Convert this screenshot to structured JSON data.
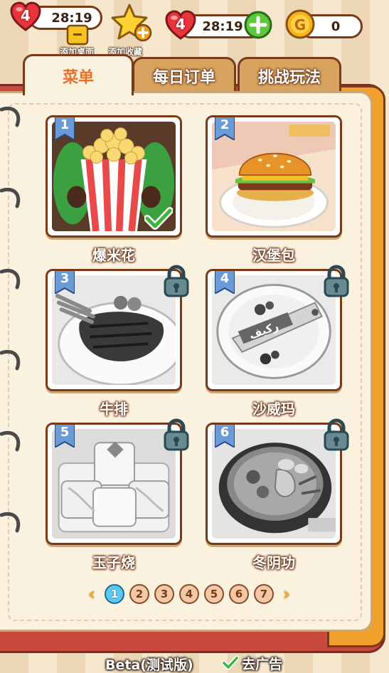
{
  "hud": {
    "left_lives": "4",
    "left_timer": "28:19",
    "right_lives": "4",
    "right_timer": "28:19",
    "coins": "0",
    "add_desktop_label": "添加桌面",
    "add_favorite_label": "添加收藏"
  },
  "tabs": [
    {
      "label": "菜单",
      "active": true
    },
    {
      "label": "每日订单",
      "active": false
    },
    {
      "label": "挑战玩法",
      "active": false
    }
  ],
  "recipes": [
    {
      "number": "1",
      "name": "爆米花",
      "locked": false,
      "completed": true,
      "icon": "popcorn-icon"
    },
    {
      "number": "2",
      "name": "汉堡包",
      "locked": false,
      "completed": false,
      "icon": "burger-icon"
    },
    {
      "number": "3",
      "name": "牛排",
      "locked": true,
      "completed": false,
      "icon": "steak-icon"
    },
    {
      "number": "4",
      "name": "沙威玛",
      "locked": true,
      "completed": false,
      "icon": "shawarma-icon",
      "wrapper_text": "ركيف"
    },
    {
      "number": "5",
      "name": "玉子烧",
      "locked": true,
      "completed": false,
      "icon": "tamagoyaki-icon"
    },
    {
      "number": "6",
      "name": "冬阴功",
      "locked": true,
      "completed": false,
      "icon": "tomyum-icon"
    }
  ],
  "pager": {
    "prev_icon": "chevron-left-icon",
    "next_icon": "chevron-right-icon",
    "pages": [
      "1",
      "2",
      "3",
      "4",
      "5",
      "6",
      "7"
    ],
    "current": "1"
  },
  "footer": {
    "version_label": "Beta(测试版)",
    "remove_ads_label": "去广告"
  },
  "colors": {
    "accent_orange": "#e9722b",
    "book_red": "#c9493f",
    "page_cream": "#fbf1df",
    "outline_brown": "#7a3a1a",
    "active_page_blue": "#5fc8f0"
  }
}
